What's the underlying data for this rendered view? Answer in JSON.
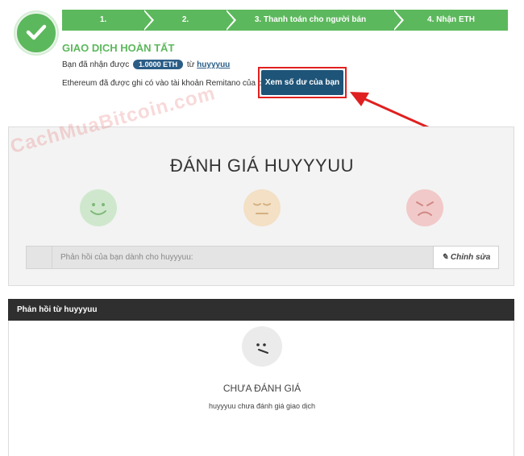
{
  "steps": [
    {
      "label": "1."
    },
    {
      "label": "2."
    },
    {
      "label": "3. Thanh toán cho người bán"
    },
    {
      "label": "4. Nhận ETH"
    }
  ],
  "status": {
    "title": "GIAO DỊCH HOÀN TẤT",
    "received_prefix": "Bạn đã nhận được",
    "amount": "1.0000 ETH",
    "from_word": "từ",
    "username": "huyyyuu",
    "credited_text": "Ethereum đã được ghi có vào tài khoản Remitano của bạn.",
    "balance_button": "Xem số dư của bạn"
  },
  "watermark": "CachMuaBitcoin.com",
  "rating": {
    "title": "ĐÁNH GIÁ HUYYYUU",
    "faces": [
      "smile-face-icon",
      "neutral-face-icon",
      "angry-face-icon"
    ],
    "feedback_placeholder": "Phản hồi của bạn dành cho huyyyuu:",
    "edit_button": "Chỉnh sửa"
  },
  "feedback_from": {
    "header": "Phản hồi từ huyyyuu",
    "status": "CHƯA ĐÁNH GIÁ",
    "status_sub": "huyyyuu chưa đánh giá giao dịch"
  },
  "colors": {
    "green": "#5cb85c",
    "dark_blue": "#1e5478",
    "highlight_red": "#e02020"
  }
}
